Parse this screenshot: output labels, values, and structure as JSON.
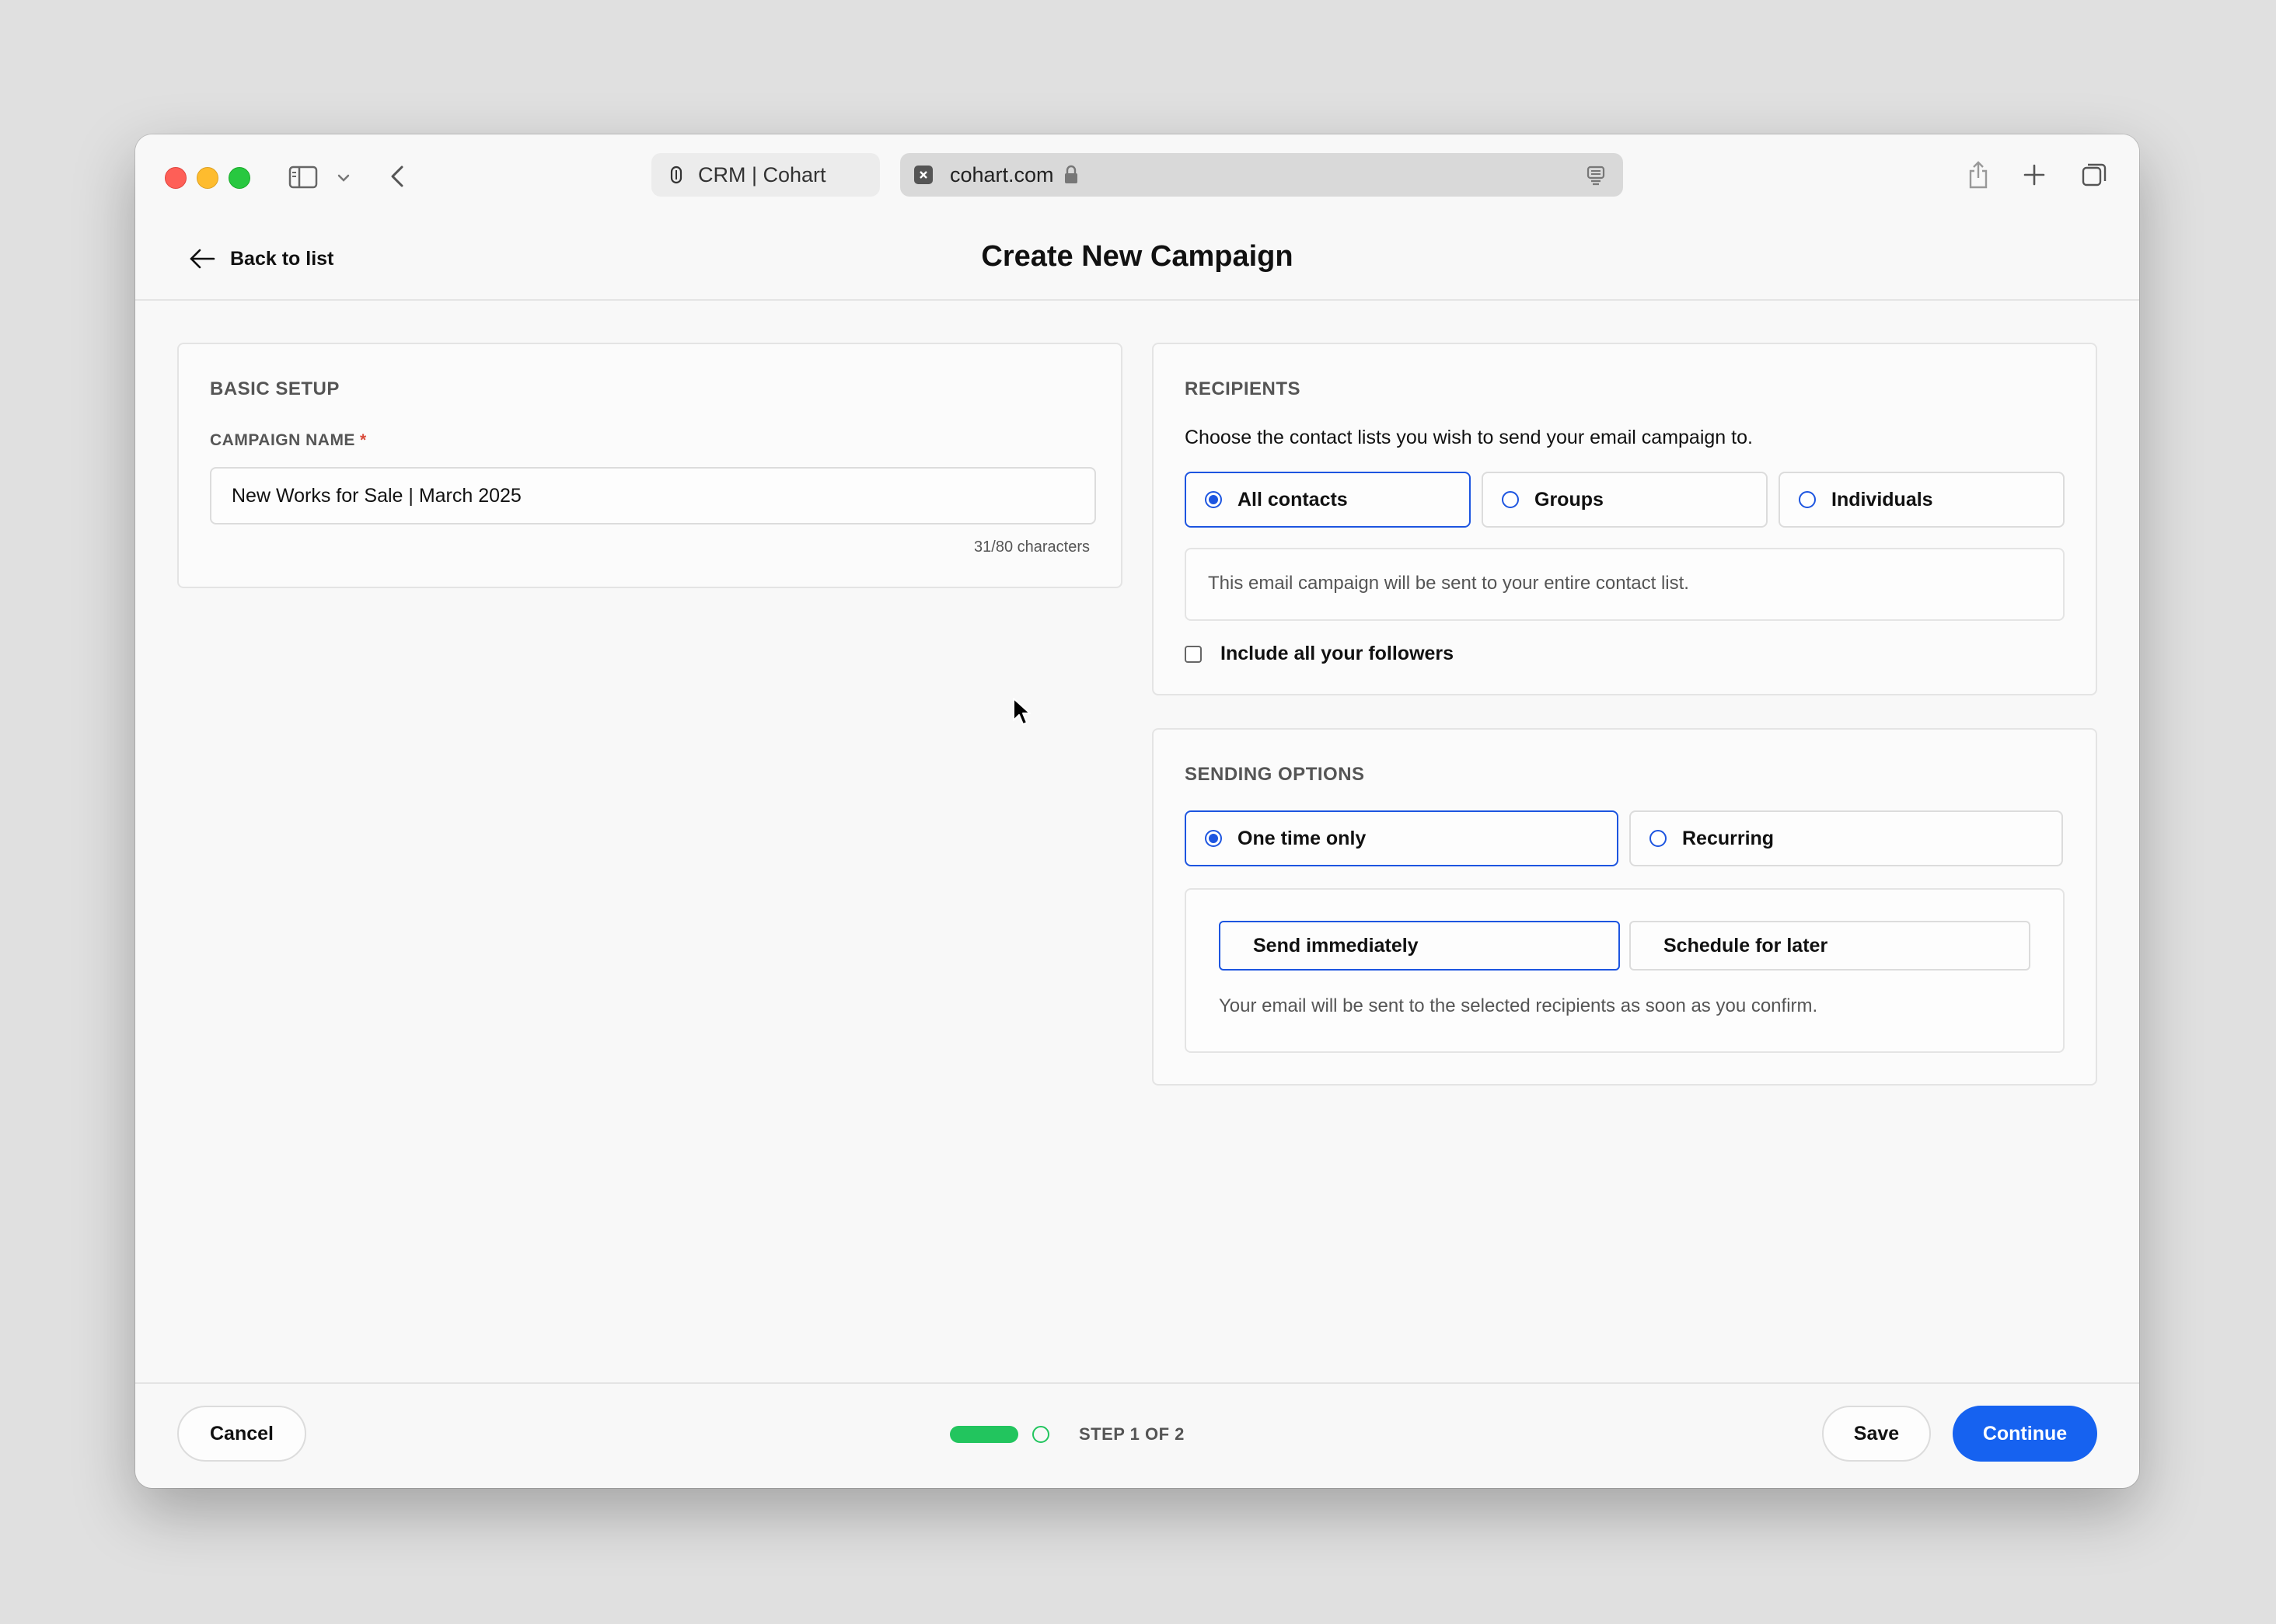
{
  "browser": {
    "tab_title": "CRM | Cohart",
    "address": "cohart.com"
  },
  "header": {
    "back_label": "Back to list",
    "title": "Create New Campaign"
  },
  "basic_setup": {
    "title": "BASIC SETUP",
    "campaign_name_label": "CAMPAIGN NAME",
    "required_mark": "*",
    "campaign_name_value": "New Works for Sale | March 2025",
    "char_count": "31/80 characters"
  },
  "recipients": {
    "title": "RECIPIENTS",
    "description": "Choose the contact lists you wish to send your email campaign to.",
    "options": [
      {
        "label": "All contacts",
        "selected": true
      },
      {
        "label": "Groups",
        "selected": false
      },
      {
        "label": "Individuals",
        "selected": false
      }
    ],
    "info_text": "This email campaign will be sent to your entire contact list.",
    "followers_label": "Include all your followers"
  },
  "sending_options": {
    "title": "SENDING OPTIONS",
    "options": [
      {
        "label": "One time only",
        "selected": true
      },
      {
        "label": "Recurring",
        "selected": false
      }
    ],
    "send_immediately_label": "Send immediately",
    "schedule_later_label": "Schedule for later",
    "info_text": "Your email will be sent to the selected recipients as soon as you confirm."
  },
  "footer": {
    "cancel_label": "Cancel",
    "step_label": "STEP 1 OF 2",
    "save_label": "Save",
    "continue_label": "Continue"
  },
  "colors": {
    "accent": "#1d55e0",
    "primary_button": "#1662f0",
    "progress": "#22c55e",
    "required": "#d94a3a"
  }
}
